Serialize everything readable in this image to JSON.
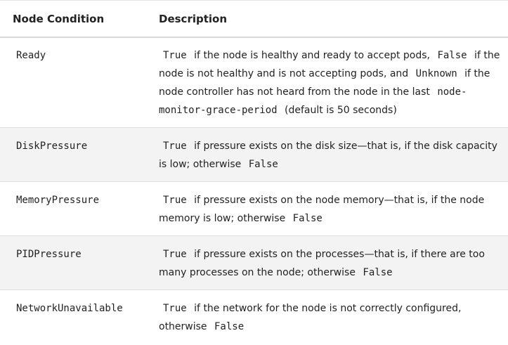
{
  "table": {
    "headers": {
      "condition": "Node Condition",
      "description": "Description"
    },
    "rows": [
      {
        "condition": "Ready",
        "parts": [
          {
            "code": "True"
          },
          {
            "text": " if the node is healthy and ready to accept pods, "
          },
          {
            "code": "False"
          },
          {
            "text": " if the node is not healthy and is not accepting pods, and "
          },
          {
            "code": "Unknown"
          },
          {
            "text": " if the node controller has not heard from the node in the last "
          },
          {
            "code": "node-monitor-grace-period"
          },
          {
            "text": " (default is 50 seconds)"
          }
        ]
      },
      {
        "condition": "DiskPressure",
        "parts": [
          {
            "code": "True"
          },
          {
            "text": " if pressure exists on the disk size—that is, if the disk capacity is low; otherwise "
          },
          {
            "code": "False"
          }
        ]
      },
      {
        "condition": "MemoryPressure",
        "parts": [
          {
            "code": "True"
          },
          {
            "text": " if pressure exists on the node memory—that is, if the node memory is low; otherwise "
          },
          {
            "code": "False"
          }
        ]
      },
      {
        "condition": "PIDPressure",
        "parts": [
          {
            "code": "True"
          },
          {
            "text": " if pressure exists on the processes—that is, if there are too many processes on the node; otherwise "
          },
          {
            "code": "False"
          }
        ]
      },
      {
        "condition": "NetworkUnavailable",
        "parts": [
          {
            "code": "True"
          },
          {
            "text": " if the network for the node is not correctly configured, otherwise "
          },
          {
            "code": "False"
          }
        ]
      }
    ]
  }
}
